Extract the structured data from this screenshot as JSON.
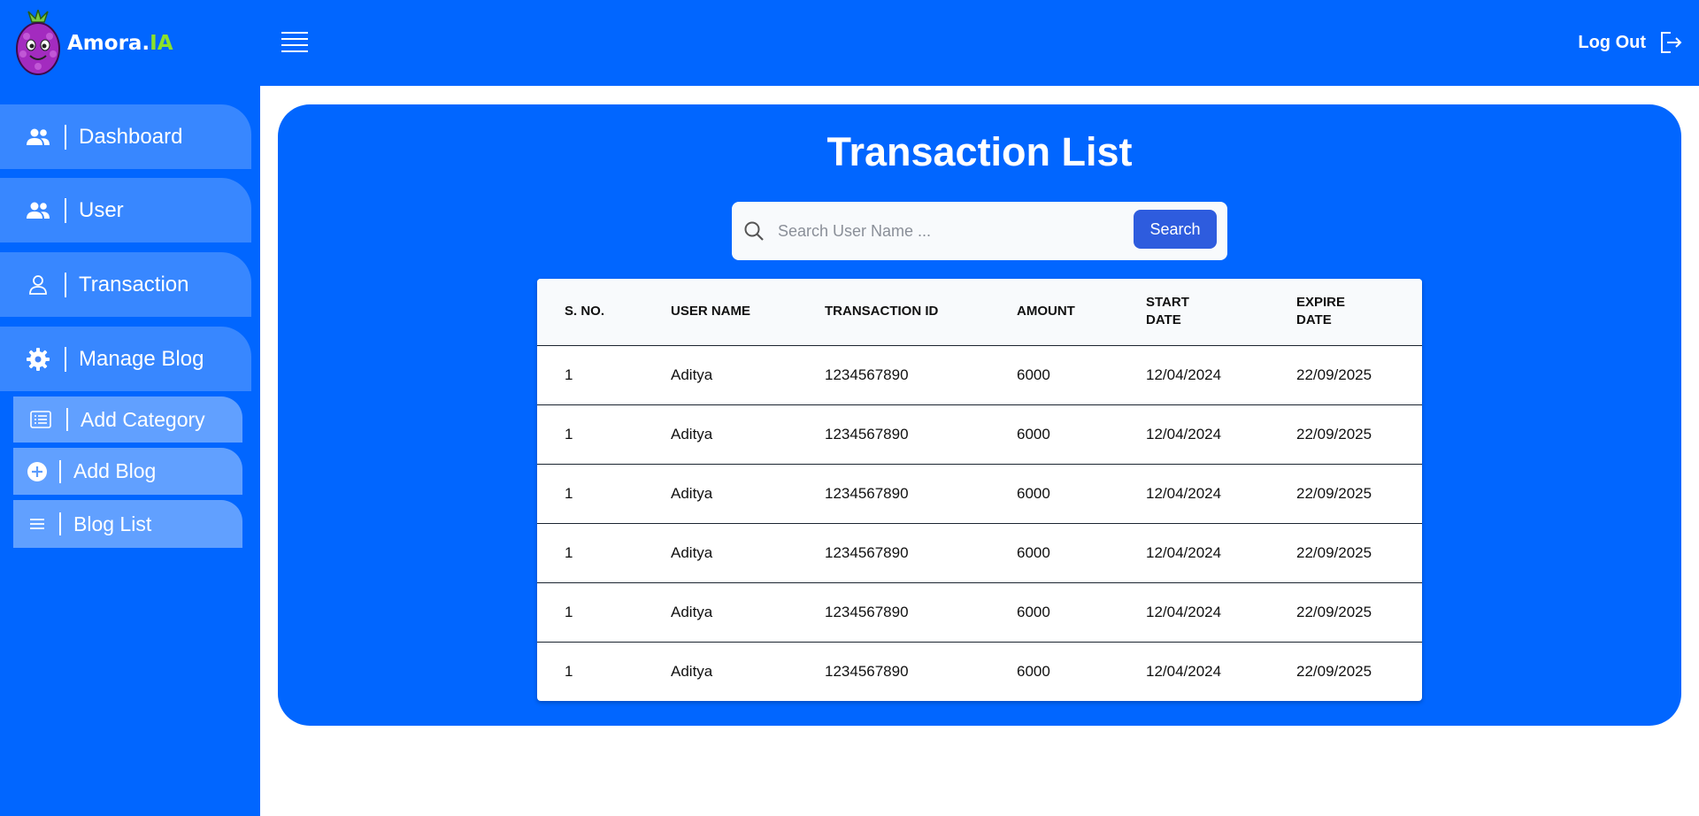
{
  "brand": {
    "name_main": "Amora.",
    "name_accent": "IA"
  },
  "sidebar": {
    "items": [
      {
        "label": "Dashboard",
        "icon": "users-icon"
      },
      {
        "label": "User",
        "icon": "users-icon"
      },
      {
        "label": "Transaction",
        "icon": "user-icon"
      },
      {
        "label": "Manage Blog",
        "icon": "gear-icon"
      }
    ],
    "sub_items": [
      {
        "label": "Add Category",
        "icon": "list-box-icon"
      },
      {
        "label": "Add Blog",
        "icon": "plus-circle-icon"
      },
      {
        "label": "Blog List",
        "icon": "list-icon"
      }
    ]
  },
  "header": {
    "logout_label": "Log Out"
  },
  "main": {
    "title": "Transaction List",
    "search": {
      "placeholder": "Search User Name ...",
      "value": "",
      "button_label": "Search"
    },
    "table": {
      "columns": [
        "S. NO.",
        "USER NAME",
        "TRANSACTION ID",
        "AMOUNT",
        "START DATE",
        "EXPIRE DATE"
      ],
      "rows": [
        [
          "1",
          "Aditya",
          "1234567890",
          "6000",
          "12/04/2024",
          "22/09/2025"
        ],
        [
          "1",
          "Aditya",
          "1234567890",
          "6000",
          "12/04/2024",
          "22/09/2025"
        ],
        [
          "1",
          "Aditya",
          "1234567890",
          "6000",
          "12/04/2024",
          "22/09/2025"
        ],
        [
          "1",
          "Aditya",
          "1234567890",
          "6000",
          "12/04/2024",
          "22/09/2025"
        ],
        [
          "1",
          "Aditya",
          "1234567890",
          "6000",
          "12/04/2024",
          "22/09/2025"
        ],
        [
          "1",
          "Aditya",
          "1234567890",
          "6000",
          "12/04/2024",
          "22/09/2025"
        ]
      ]
    }
  },
  "colors": {
    "primary": "#0166ff",
    "button": "#2e5cde",
    "accent": "#8be02a"
  }
}
